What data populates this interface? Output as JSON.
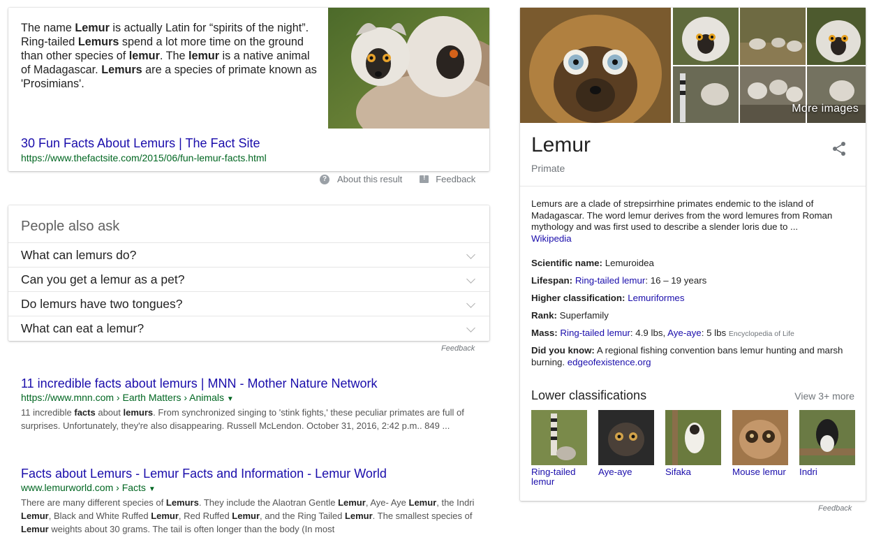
{
  "snippet": {
    "text_parts": [
      {
        "t": "The name ",
        "b": false
      },
      {
        "t": "Lemur",
        "b": true
      },
      {
        "t": " is actually Latin for “spirits of the night”. Ring-tailed ",
        "b": false
      },
      {
        "t": "Lemurs",
        "b": true
      },
      {
        "t": " spend a lot more time on the ground than other species of ",
        "b": false
      },
      {
        "t": "lemur",
        "b": true
      },
      {
        "t": ". The ",
        "b": false
      },
      {
        "t": "lemur",
        "b": true
      },
      {
        "t": " is a native animal of Madagascar. ",
        "b": false
      },
      {
        "t": "Lemurs",
        "b": true
      },
      {
        "t": " are a species of primate known as 'Prosimians'.",
        "b": false
      }
    ],
    "title": "30 Fun Facts About Lemurs | The Fact Site",
    "url": "https://www.thefactsite.com/2015/06/fun-lemur-facts.html",
    "about_label": "About this result",
    "feedback_label": "Feedback"
  },
  "paa": {
    "heading": "People also ask",
    "questions": [
      "What can lemurs do?",
      "Can you get a lemur as a pet?",
      "Do lemurs have two tongues?",
      "What can eat a lemur?"
    ],
    "feedback_label": "Feedback"
  },
  "results": [
    {
      "title": "11 incredible facts about lemurs | MNN - Mother Nature Network",
      "url": "https://www.mnn.com › Earth Matters › Animals",
      "desc_parts": [
        {
          "t": "11 incredible ",
          "b": false
        },
        {
          "t": "facts",
          "b": true
        },
        {
          "t": " about ",
          "b": false
        },
        {
          "t": "lemurs",
          "b": true
        },
        {
          "t": ". From synchronized singing to 'stink fights,' these peculiar primates are full of surprises. Unfortunately, they're also disappearing. Russell McLendon. October 31, 2016, 2:42 p.m.. 849 ...",
          "b": false
        }
      ]
    },
    {
      "title": "Facts about Lemurs - Lemur Facts and Information - Lemur World",
      "url": "www.lemurworld.com › Facts",
      "desc_parts": [
        {
          "t": "There are many different species of ",
          "b": false
        },
        {
          "t": "Lemurs",
          "b": true
        },
        {
          "t": ". They include the Alaotran Gentle ",
          "b": false
        },
        {
          "t": "Lemur",
          "b": true
        },
        {
          "t": ", Aye- Aye ",
          "b": false
        },
        {
          "t": "Lemur",
          "b": true
        },
        {
          "t": ", the Indri ",
          "b": false
        },
        {
          "t": "Lemur",
          "b": true
        },
        {
          "t": ", Black and White Ruffed ",
          "b": false
        },
        {
          "t": "Lemur",
          "b": true
        },
        {
          "t": ", Red Ruffed ",
          "b": false
        },
        {
          "t": "Lemur",
          "b": true
        },
        {
          "t": ", and the Ring Tailed ",
          "b": false
        },
        {
          "t": "Lemur",
          "b": true
        },
        {
          "t": ". The smallest species of ",
          "b": false
        },
        {
          "t": "Lemur",
          "b": true
        },
        {
          "t": " weights about 30 grams. The tail is often longer than the body (In most",
          "b": false
        }
      ]
    }
  ],
  "panel": {
    "more_images_label": "More images",
    "title": "Lemur",
    "subtitle": "Primate",
    "description": "Lemurs are a clade of strepsirrhine primates endemic to the island of Madagascar. The word lemur derives from the word lemures from Roman mythology and was first used to describe a slender loris due to ...",
    "description_source": "Wikipedia",
    "scientific_name": {
      "label": "Scientific name:",
      "value": "Lemuroidea"
    },
    "lifespan": {
      "label": "Lifespan:",
      "link": "Ring-tailed lemur",
      "value": ": 16 – 19 years"
    },
    "higher_classification": {
      "label": "Higher classification:",
      "link": "Lemuriformes"
    },
    "rank": {
      "label": "Rank:",
      "value": "Superfamily"
    },
    "mass": {
      "label": "Mass:",
      "link1": "Ring-tailed lemur",
      "value1": ": 4.9 lbs, ",
      "link2": "Aye-aye",
      "value2": ": 5 lbs",
      "source": "Encyclopedia of Life"
    },
    "did_you_know": {
      "label": "Did you know:",
      "value": "A regional fishing convention bans lemur hunting and marsh burning.",
      "source": "edgeofexistence.org"
    },
    "lower_title": "Lower classifications",
    "lower_more": "View 3+ more",
    "lower": [
      {
        "label": "Ring-tailed lemur"
      },
      {
        "label": "Aye-aye"
      },
      {
        "label": "Sifaka"
      },
      {
        "label": "Mouse lemur"
      },
      {
        "label": "Indri"
      }
    ],
    "feedback_label": "Feedback"
  }
}
